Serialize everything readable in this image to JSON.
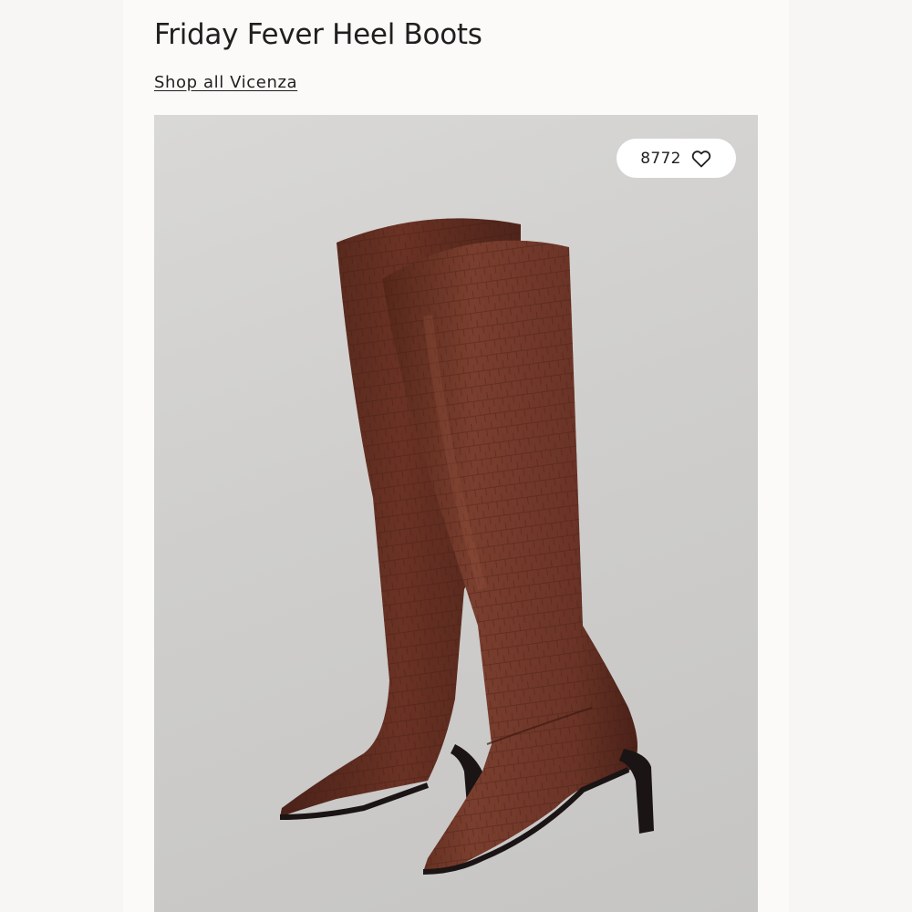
{
  "product": {
    "title": "Friday Fever Heel Boots",
    "shop_link_label": "Shop all Vicenza"
  },
  "likes": {
    "count": "8772",
    "icon": "heart-outline-icon"
  },
  "image": {
    "subject": "boots-photo",
    "colors": {
      "background": "#cfcecc",
      "leather": "#5a2a1f",
      "leather_highlight": "#7a3e2e",
      "sole": "#1a1414"
    }
  }
}
